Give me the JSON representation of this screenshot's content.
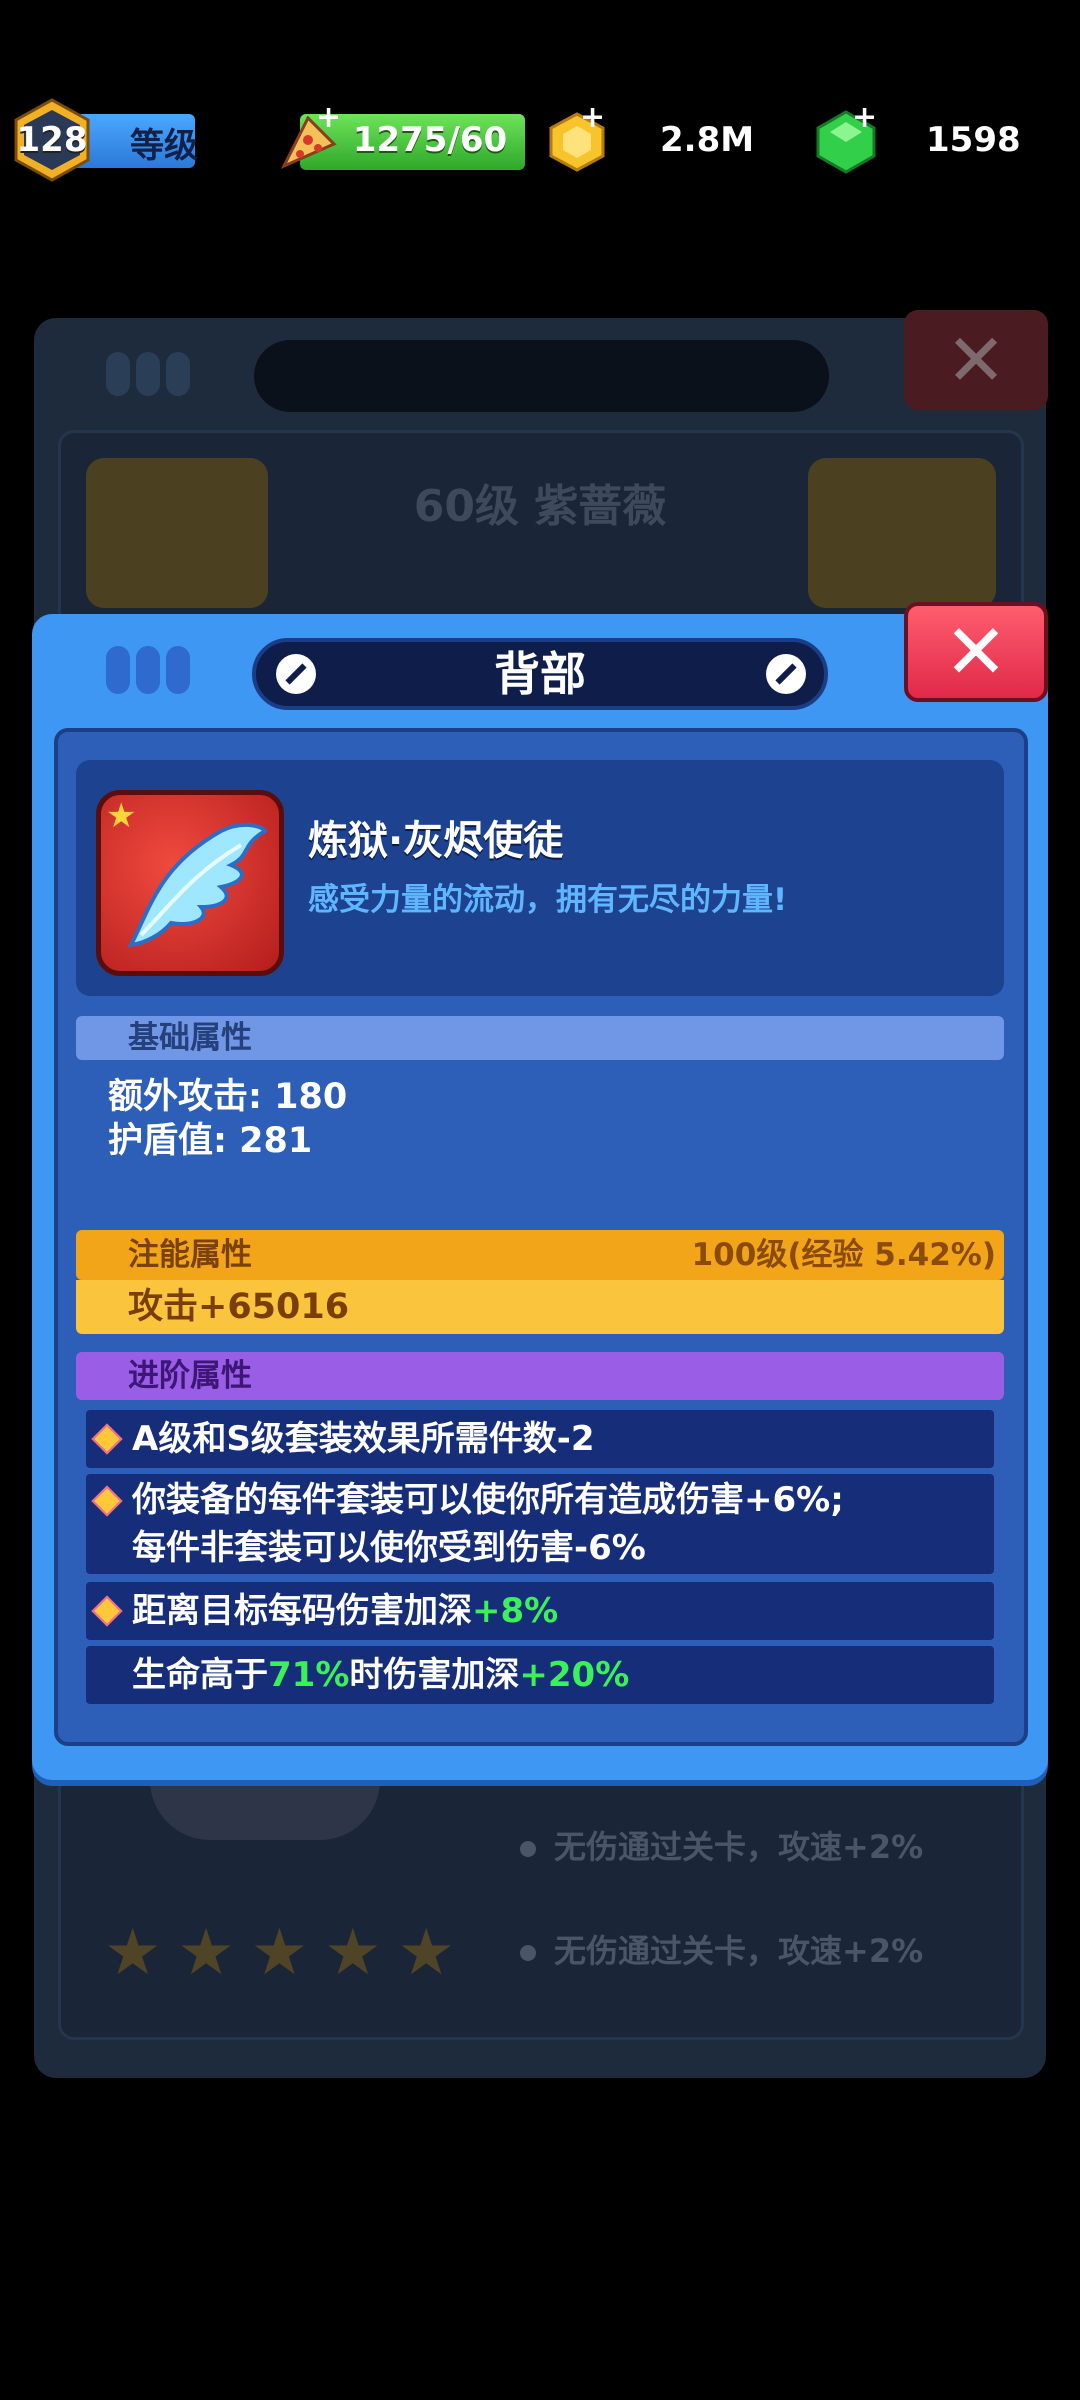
{
  "hud": {
    "level": "128",
    "level_label": "等级",
    "energy": "1275/60",
    "coins": "2.8M",
    "gems": "1598",
    "plus": "+"
  },
  "background": {
    "title": "60级 紫蔷薇",
    "rows": [
      "无伤通过关卡，攻速+2%",
      "无伤通过关卡，攻速+2%"
    ]
  },
  "modal": {
    "title": "背部",
    "close": "✕",
    "item": {
      "name": "炼狱·灰烬使徒",
      "description": "感受力量的流动，拥有无尽的力量!"
    },
    "base_section": {
      "header": "基础属性",
      "stats": [
        "额外攻击: 180",
        "护盾值: 281"
      ]
    },
    "energy_section": {
      "header": "注能属性",
      "level": "100级(经验 5.42%)",
      "value": "攻击+65016"
    },
    "advanced_section": {
      "header": "进阶属性",
      "row1": "A级和S级套装效果所需件数-2",
      "row2_line1": "你装备的每件套装可以使你所有造成伤害+6%;",
      "row2_line2": "每件非套装可以使你受到伤害-6%",
      "row3_text": "距离目标每码伤害加深",
      "row3_value": "+8%",
      "row4_a": "生命高于",
      "row4_pct": "71%",
      "row4_b": "时伤害加深",
      "row4_value": "+20%"
    }
  },
  "colors": {
    "modal_blue": "#3f97f4",
    "close_red": "#e0294a",
    "energy_orange": "#f3a51a",
    "advanced_purple": "#9a5ee6",
    "highlight_green": "#3cf05a"
  }
}
